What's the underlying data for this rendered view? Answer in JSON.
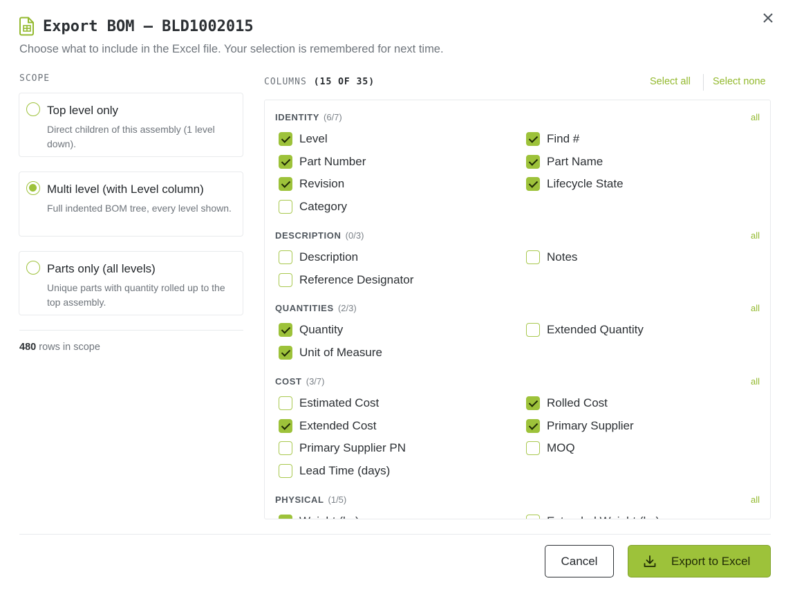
{
  "header": {
    "title": "Export BOM — BLD1002015",
    "subtitle": "Choose what to include in the Excel file. Your selection is remembered for next time."
  },
  "scope": {
    "label": "SCOPE",
    "options": [
      {
        "title": "Top level only",
        "desc": "Direct children of this assembly (1 level down).",
        "selected": false
      },
      {
        "title": "Multi level (with Level column)",
        "desc": "Full indented BOM tree, every level shown.",
        "selected": true
      },
      {
        "title": "Parts only (all levels)",
        "desc": "Unique parts with quantity rolled up to the top assembly.",
        "selected": false
      }
    ],
    "rows_count": "480",
    "rows_suffix": "rows in scope"
  },
  "columns": {
    "label": "COLUMNS",
    "count": "(15 OF 35)",
    "select_all": "Select all",
    "select_none": "Select none",
    "groups": [
      {
        "title": "IDENTITY",
        "count": "(6/7)",
        "all": "all",
        "items": [
          {
            "label": "Level",
            "checked": true
          },
          {
            "label": "Find #",
            "checked": true
          },
          {
            "label": "Part Number",
            "checked": true
          },
          {
            "label": "Part Name",
            "checked": true
          },
          {
            "label": "Revision",
            "checked": true
          },
          {
            "label": "Lifecycle State",
            "checked": true
          },
          {
            "label": "Category",
            "checked": false
          }
        ]
      },
      {
        "title": "DESCRIPTION",
        "count": "(0/3)",
        "all": "all",
        "items": [
          {
            "label": "Description",
            "checked": false
          },
          {
            "label": "Notes",
            "checked": false
          },
          {
            "label": "Reference Designator",
            "checked": false
          }
        ]
      },
      {
        "title": "QUANTITIES",
        "count": "(2/3)",
        "all": "all",
        "items": [
          {
            "label": "Quantity",
            "checked": true
          },
          {
            "label": "Extended Quantity",
            "checked": false
          },
          {
            "label": "Unit of Measure",
            "checked": true
          }
        ]
      },
      {
        "title": "COST",
        "count": "(3/7)",
        "all": "all",
        "items": [
          {
            "label": "Estimated Cost",
            "checked": false
          },
          {
            "label": "Rolled Cost",
            "checked": true
          },
          {
            "label": "Extended Cost",
            "checked": true
          },
          {
            "label": "Primary Supplier",
            "checked": true
          },
          {
            "label": "Primary Supplier PN",
            "checked": false
          },
          {
            "label": "MOQ",
            "checked": false
          },
          {
            "label": "Lead Time (days)",
            "checked": false
          }
        ]
      },
      {
        "title": "PHYSICAL",
        "count": "(1/5)",
        "all": "all",
        "items": [
          {
            "label": "Weight (kg)",
            "checked": true
          },
          {
            "label": "Extended Weight (kg)",
            "checked": false
          }
        ]
      }
    ]
  },
  "footer": {
    "cancel": "Cancel",
    "export": "Export to Excel"
  },
  "colors": {
    "accent": "#9dc23a",
    "accent_text": "#93b92e",
    "text": "#2b2f33",
    "muted": "#6e747b"
  }
}
